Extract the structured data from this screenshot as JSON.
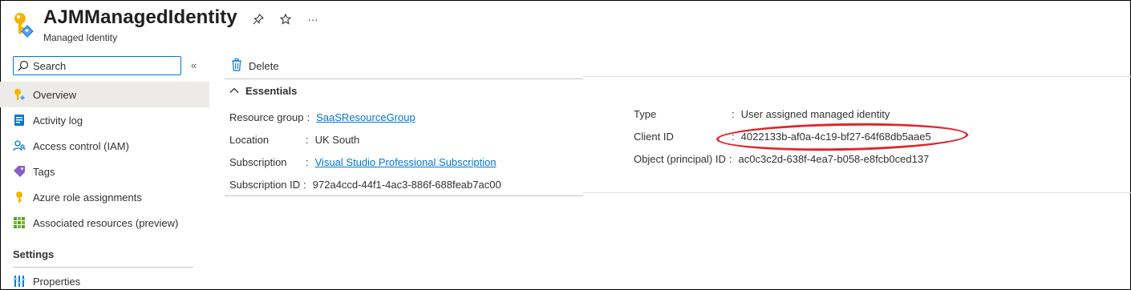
{
  "header": {
    "title": "AJMManagedIdentity",
    "subtitle": "Managed Identity",
    "icons": [
      "managed-identity-icon",
      "pin-icon",
      "star-icon",
      "more-icon"
    ],
    "more_label": "···"
  },
  "sidebar": {
    "search": {
      "placeholder": "Search",
      "value": ""
    },
    "collapse_label": "«",
    "items": [
      {
        "label": "Overview",
        "icon": "overview-icon",
        "active": true
      },
      {
        "label": "Activity log",
        "icon": "activity-log-icon"
      },
      {
        "label": "Access control (IAM)",
        "icon": "access-control-icon"
      },
      {
        "label": "Tags",
        "icon": "tag-icon"
      },
      {
        "label": "Azure role assignments",
        "icon": "key-icon"
      },
      {
        "label": "Associated resources (preview)",
        "icon": "grid-icon"
      }
    ],
    "section_title": "Settings",
    "properties": {
      "label": "Properties",
      "icon": "properties-icon"
    }
  },
  "toolbar": {
    "delete_label": "Delete"
  },
  "essentials": {
    "header": "Essentials",
    "left": [
      {
        "key": "Resource group",
        "value": "SaaSResourceGroup",
        "link": true
      },
      {
        "key": "Location",
        "value": "UK South",
        "link": false
      },
      {
        "key": "Subscription",
        "value": "Visual Studio Professional Subscription",
        "link": true
      },
      {
        "key": "Subscription ID",
        "value": "972a4ccd-44f1-4ac3-886f-688feab7ac00",
        "link": false
      }
    ],
    "right": [
      {
        "key": "Type",
        "value": "User assigned managed identity"
      },
      {
        "key": "Client ID",
        "value": "4022133b-af0a-4c19-bf27-64f68db5aae5"
      },
      {
        "key": "Object (principal) ID",
        "value": "ac0c3c2d-638f-4ea7-b058-e8fcb0ced137"
      }
    ],
    "separator": ":"
  },
  "colors": {
    "accent": "#0078d4",
    "annotation": "#e0262d",
    "active_bg": "#edebe9"
  }
}
